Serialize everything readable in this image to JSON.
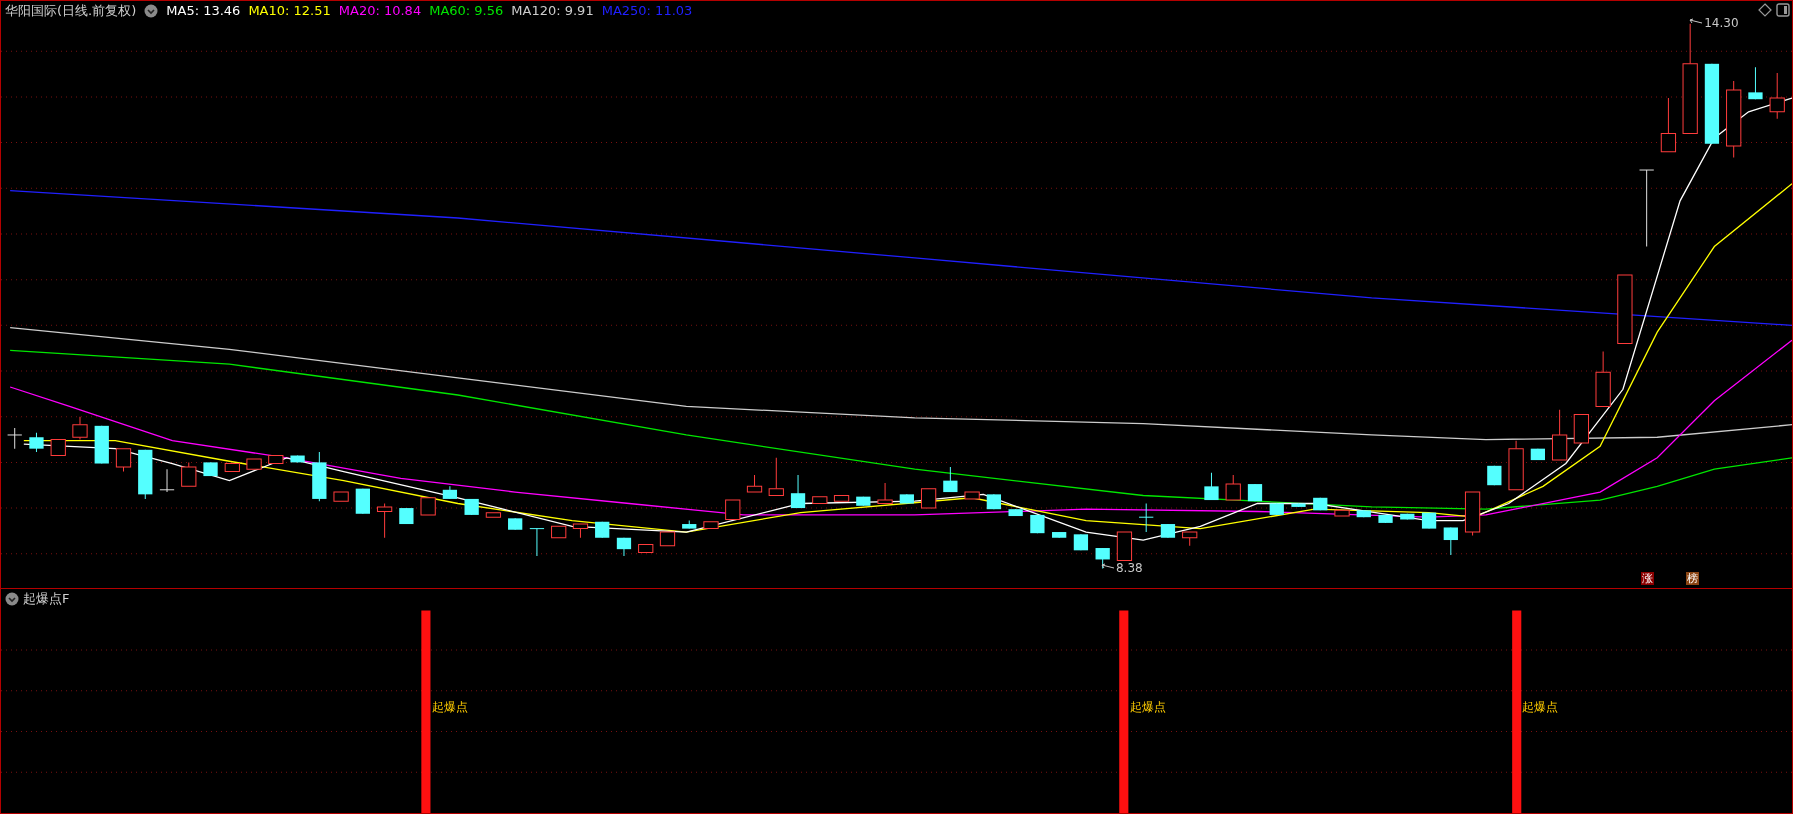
{
  "chart_header": {
    "title": "华阳国际(日线.前复权)",
    "indicators": [
      {
        "label": "MA5: 13.46",
        "color": "#ffffff"
      },
      {
        "label": "MA10: 12.51",
        "color": "#ffff00"
      },
      {
        "label": "MA20: 10.84",
        "color": "#ff00ff"
      },
      {
        "label": "MA60: 9.56",
        "color": "#00e600"
      },
      {
        "label": "MA120: 9.91",
        "color": "#cccccc"
      },
      {
        "label": "MA250: 11.03",
        "color": "#2020ff"
      }
    ]
  },
  "price_labels": [
    {
      "kind": "high",
      "text": "14.30"
    },
    {
      "kind": "low",
      "text": "8.38"
    }
  ],
  "markers": [
    {
      "text": "涨",
      "color": "#8b0000"
    },
    {
      "text": "榜",
      "color": "#8b4513"
    }
  ],
  "indicator_panel": {
    "title": "起爆点F",
    "signals": [
      {
        "label": "起爆点"
      },
      {
        "label": "起爆点"
      },
      {
        "label": "起爆点"
      }
    ]
  }
}
